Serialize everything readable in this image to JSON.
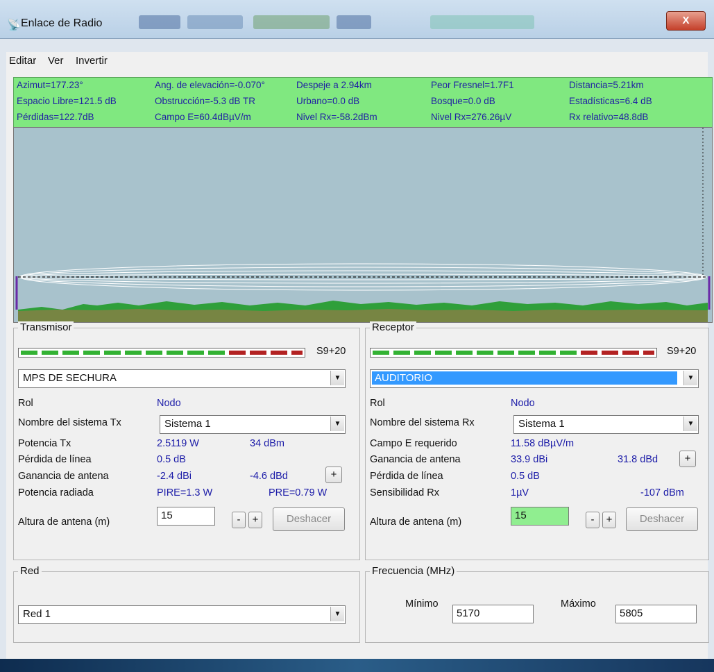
{
  "window": {
    "title": "Enlace de Radio",
    "close": "X"
  },
  "menu": [
    "Editar",
    "Ver",
    "Invertir"
  ],
  "stats": [
    [
      "Azimut=177.23°",
      "Ang. de elevación=-0.070°",
      "Despeje a 2.94km",
      "Peor Fresnel=1.7F1",
      "Distancia=5.21km"
    ],
    [
      "Espacio Libre=121.5 dB",
      "Obstrucción=-5.3 dB TR",
      "Urbano=0.0 dB",
      "Bosque=0.0 dB",
      "Estadísticas=6.4 dB"
    ],
    [
      "Pérdidas=122.7dB",
      "Campo E=60.4dBµV/m",
      "Nivel Rx=-58.2dBm",
      "Nivel Rx=276.26µV",
      "Rx relativo=48.8dB"
    ]
  ],
  "transmisor": {
    "title": "Transmisor",
    "s_label": "S9+20",
    "station": "MPS DE SECHURA",
    "rol_label": "Rol",
    "rol_value": "Nodo",
    "sistema_label": "Nombre del sistema Tx",
    "sistema_value": "Sistema  1",
    "potencia_label": "Potencia Tx",
    "potencia_w": "2.5119 W",
    "potencia_dbm": "34 dBm",
    "perdida_label": "Pérdida de línea",
    "perdida_value": "0.5 dB",
    "ganancia_label": "Ganancia de antena",
    "ganancia_dbi": "-2.4 dBi",
    "ganancia_dbd": "-4.6 dBd",
    "radiada_label": "Potencia radiada",
    "pire": "PIRE=1.3 W",
    "pre": "PRE=0.79 W",
    "altura_label": "Altura de antena (m)",
    "altura_value": "15",
    "undo": "Deshacer"
  },
  "receptor": {
    "title": "Receptor",
    "s_label": "S9+20",
    "station": "AUDITORIO",
    "rol_label": "Rol",
    "rol_value": "Nodo",
    "sistema_label": "Nombre del sistema Rx",
    "sistema_value": "Sistema  1",
    "campo_label": "Campo E requerido",
    "campo_value": "11.58 dBµV/m",
    "ganancia_label": "Ganancia de antena",
    "ganancia_dbi": "33.9 dBi",
    "ganancia_dbd": "31.8 dBd",
    "perdida_label": "Pérdida de línea",
    "perdida_value": "0.5 dB",
    "sens_label": "Sensibilidad Rx",
    "sens_uv": "1µV",
    "sens_dbm": "-107 dBm",
    "altura_label": "Altura de antena (m)",
    "altura_value": "15",
    "undo": "Deshacer"
  },
  "red": {
    "title": "Red",
    "value": "Red 1"
  },
  "frecuencia": {
    "title": "Frecuencia (MHz)",
    "min_label": "Mínimo",
    "min_value": "5170",
    "max_label": "Máximo",
    "max_value": "5805"
  },
  "buttons": {
    "minus": "-",
    "plus": "+"
  },
  "colors": {
    "stats_bg": "#80e880",
    "profile_bg": "#a8c2cc",
    "value_text": "#1c1ca8",
    "selection": "#3399ff"
  }
}
